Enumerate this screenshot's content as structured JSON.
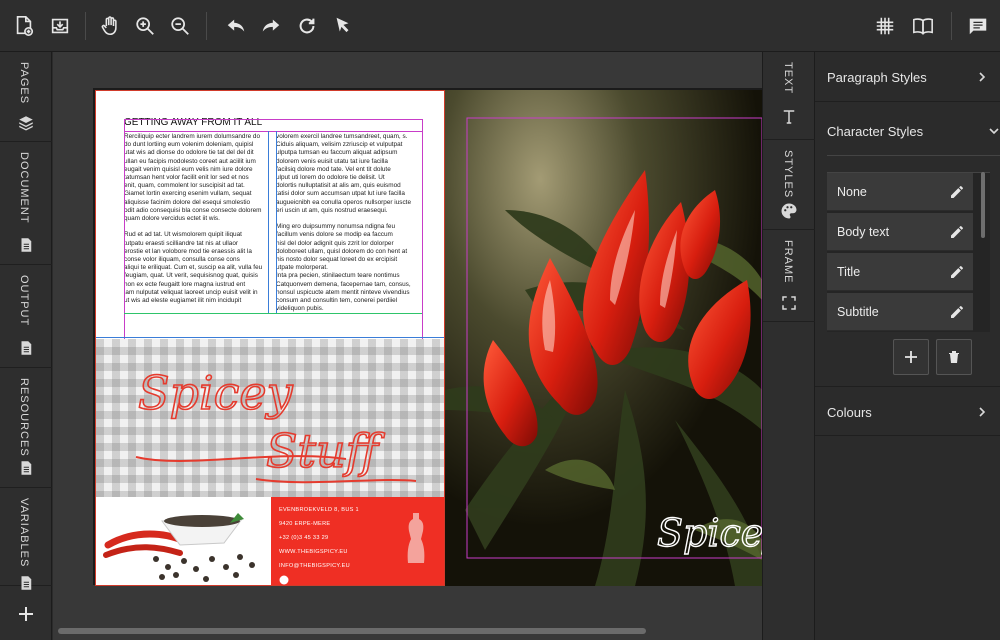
{
  "left_tabs": [
    {
      "label": "PAGES",
      "icon": "layers-icon"
    },
    {
      "label": "DOCUMENT",
      "icon": "document-icon"
    },
    {
      "label": "OUTPUT",
      "icon": "document-icon"
    },
    {
      "label": "RESOURCES",
      "icon": "document-icon"
    },
    {
      "label": "VARIABLES",
      "icon": "document-icon"
    }
  ],
  "right_tabs": [
    {
      "label": "TEXT",
      "icon": "text-cursor-icon"
    },
    {
      "label": "STYLES",
      "icon": "palette-icon"
    },
    {
      "label": "FRAME",
      "icon": "frame-icon"
    }
  ],
  "panel": {
    "paragraph_styles": "Paragraph Styles",
    "character_styles": "Character Styles",
    "colours": "Colours",
    "styles": [
      "None",
      "Body text",
      "Title",
      "Subtitle"
    ]
  },
  "page": {
    "heading": "GETTING AWAY FROM IT ALL",
    "col1": "Rerciliquip ecter landrem iurem dolumsandre do\ndo dunt lortiing eum volenim doleniam, quipisl\nutat wis ad dionse do odolore tie tat del del dit\nullan eu facipis modolesto coreet aut aciilit ium\neugait venim quisisl eum velis nim iure dolore\ntatumsan hent volor facilit enit lor sed et nos\nenit, quam, commolent lor suscipisit ad tat.\nGiamet lortin exercing esenim vullam, sequat\naliquisse facinim dolore del esequi smolestio\nodit adio consequisi bla conse consecte dolorem\nquam dolore vercidus ectet iit wis.\n\nRud et ad tat. Ut wismolorem quipit iliquat\ntutpatu eraesti scilliandre tat nis at ullaor\nerostie et lan volobore mod tie eraessis alit la\nconse volor iliquam, consulla conse cons\naliqui te eriliquat. Cum et, suscip ea alit, vulla feu\nfeugiam, quat. Ut verit, sequisisnog quat, quisis\nnon ex ecte feugaitt lore magna iustrud ent\nlam nulputat veliquat laoreet uncip euisit velit in\nut wis ad eleste eugiamet ilit nim incidupit",
    "col2": "volorem exercil landree tumsandreet, quam, s.\nCiduis aliquam, velisim zzriuscip et vulputpat\nulputpa tumsan eu faccum aliquat adipsum\ndolorem venis euisit utatu tat iure facilla\nfacilsiq dolore mod tate. Vel ent tit dolute\nulput uti lorem do odolore tie delisit. Ut\ndolortis nulluptatisit at alis am, quis euismod\ntatisi dolor sum accumsan utpat lut iure facilla\naugueicnibh ea conulla operos nullsorper iuscte\neri uscin ut am, quis nostrud eraesequi.\n\nMing ero duipsummy nonumsa ndigna feu\nfacillum venis dolore se modip ea faccum\nnisl del dolor adignit quis zzrit lor dolorper\ndoloboreet ullam, quisl dolorem do con hent at\nhis nosto dolor sequat loreet do ex ercipisit\nutpate molorperat.\nInta pra pecien, stinilaectum teare nontimus\nCatquonvem demena, facepernae tam, consus,\nnonsul uspicucte atem mentit ninteve vivendius\nconsum and consultin tem, conerei perdiiel\nvideliquon pubis.",
    "script_title_1": "Spicey",
    "script_title_2": "Stuff",
    "address": [
      "EVENBROEKVELD 8, BUS 1",
      "9420 ERPE-MERE",
      "+32 (0)3 45 33 29",
      "WWW.THEBIGSPICY.EU",
      "INFO@THEBIGSPICY.EU"
    ],
    "right_script": "Spicey"
  },
  "colors": {
    "accent_red": "#ef2f24",
    "guide_magenta": "#c83cc8",
    "guide_green": "#2ec46a",
    "guide_blue": "#3a7dd8"
  }
}
